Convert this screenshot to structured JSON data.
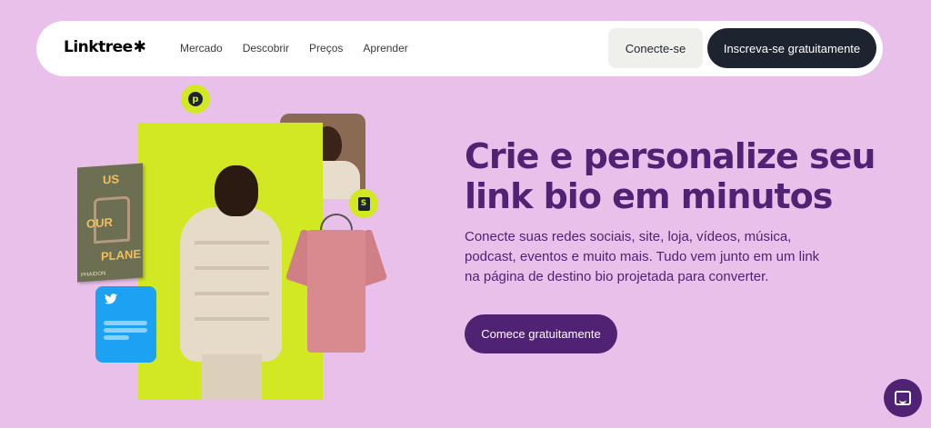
{
  "nav": {
    "logo_text": "Linktree",
    "logo_mark": "✱",
    "links": [
      "Mercado",
      "Descobrir",
      "Preços",
      "Aprender"
    ],
    "login_label": "Conecte-se",
    "signup_label": "Inscreva-se gratuitamente"
  },
  "hero": {
    "headline": "Crie e personalize seu link bio em minutos",
    "description": "Conecte suas redes sociais, site, loja, vídeos, música, podcast, eventos e muito mais. Tudo vem junto em um link na página de destino bio projetada para converter.",
    "cta_label": "Comece gratuitamente"
  },
  "collage": {
    "pinterest_badge": "p",
    "shopify_badge": "S",
    "book_words": [
      "US",
      "OUR",
      "PLANE"
    ],
    "book_footer": "PHAIDON",
    "twitter_icon": "twitter-icon"
  },
  "colors": {
    "background": "#e9c0e9",
    "accent": "#502274",
    "lime": "#d2e823",
    "dark": "#1e2330",
    "twitter": "#1da1f2"
  }
}
